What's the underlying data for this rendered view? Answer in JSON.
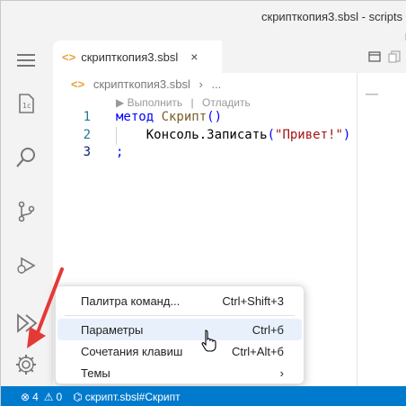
{
  "window": {
    "title": "скрипткопия3.sbsl - scripts -"
  },
  "activitybar": {
    "items": [
      "menu-icon",
      "explorer-icon",
      "search-icon",
      "source-control-icon",
      "debug-icon",
      "run-icon",
      "settings-gear-icon"
    ]
  },
  "tab": {
    "file_icon": "<>",
    "label": "скрипткопия3.sbsl",
    "close": "×"
  },
  "breadcrumb": {
    "file_icon": "<>",
    "file": "скрипткопия3.sbsl",
    "separator": "›",
    "more": "..."
  },
  "codelens": {
    "run": "▶ Выполнить",
    "sep": "|",
    "debug": "Отладить"
  },
  "code": {
    "lines": [
      {
        "n": "1",
        "tokens": [
          {
            "t": "kw",
            "v": "метод "
          },
          {
            "t": "fn",
            "v": "Скрипт"
          },
          {
            "t": "kw",
            "v": "()"
          }
        ]
      },
      {
        "n": "2",
        "tokens": [
          {
            "t": "plain",
            "v": "    Консоль.Записать"
          },
          {
            "t": "kw",
            "v": "("
          },
          {
            "t": "str",
            "v": "\"Привет!\""
          },
          {
            "t": "kw",
            "v": ")"
          }
        ]
      },
      {
        "n": "3",
        "tokens": [
          {
            "t": "kw",
            "v": ";"
          }
        ]
      }
    ]
  },
  "menu": {
    "items": [
      {
        "label": "Палитра команд...",
        "shortcut": "Ctrl+Shift+3"
      },
      {
        "label": "Параметры",
        "shortcut": "Ctrl+б"
      },
      {
        "label": "Сочетания клавиш",
        "shortcut": "Ctrl+Alt+б"
      },
      {
        "label": "Темы",
        "shortcut": "›"
      }
    ]
  },
  "statusbar": {
    "errors": "4",
    "warnings": "0",
    "location": "скрипт.sbsl#Скрипт"
  },
  "colors": {
    "accent": "#007acc",
    "keyword": "#0000ff",
    "function": "#795e26",
    "string": "#a31515",
    "file_icon": "#e8a33d",
    "annotation_arrow": "#e53935"
  }
}
